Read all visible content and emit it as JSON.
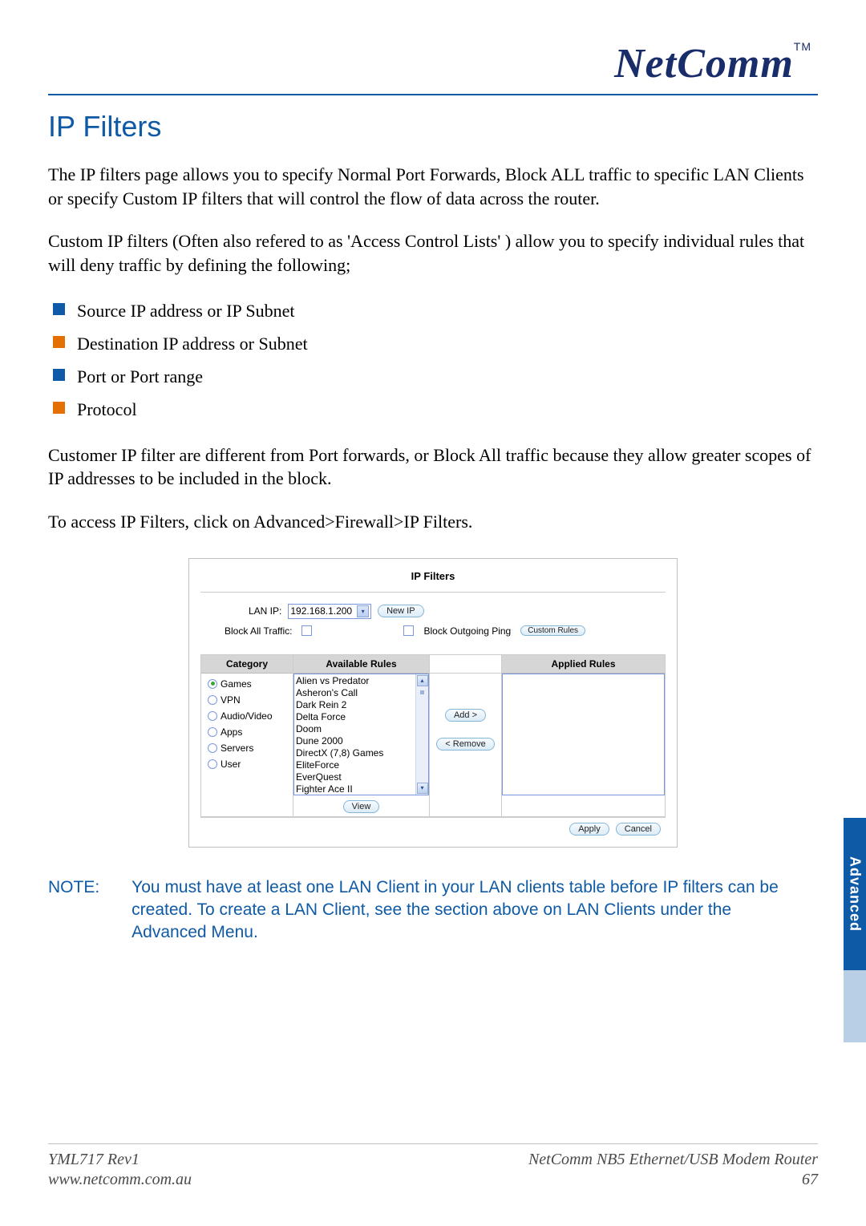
{
  "logo": {
    "text": "NetComm",
    "tm": "TM"
  },
  "title": "IP Filters",
  "paragraphs": {
    "p1": "The IP filters page allows you to specify Normal Port Forwards,  Block ALL traffic to specific LAN Clients or specify Custom IP filters that will control the flow of data across the router.",
    "p2": "Custom IP filters (Often also refered to as 'Access Control Lists' ) allow you to specify individual rules that will deny traffic by defining the following;",
    "p3": "Customer IP filter are different from Port forwards, or Block All traffic because they allow greater scopes of IP addresses to be included in the block.",
    "p4": "To access IP Filters, click on Advanced>Firewall>IP Filters."
  },
  "bullets": [
    "Source IP address or IP Subnet",
    "Destination IP address or Subnet",
    "Port or Port range",
    "Protocol"
  ],
  "panel": {
    "title": "IP Filters",
    "lanIpLabel": "LAN IP:",
    "lanIpValue": "192.168.1.200",
    "newIp": "New IP",
    "blockAllLabel": "Block All Traffic:",
    "blockPingLabel": "Block Outgoing Ping",
    "customRules": "Custom Rules",
    "headers": {
      "category": "Category",
      "available": "Available Rules",
      "applied": "Applied Rules"
    },
    "categories": [
      "Games",
      "VPN",
      "Audio/Video",
      "Apps",
      "Servers",
      "User"
    ],
    "selectedCategory": "Games",
    "availableRules": [
      "Alien vs Predator",
      "Asheron's Call",
      "Dark Rein 2",
      "Delta Force",
      "Doom",
      "Dune 2000",
      "DirectX (7,8) Games",
      "EliteForce",
      "EverQuest",
      "Fighter Ace II"
    ],
    "addBtn": "Add >",
    "removeBtn": "< Remove",
    "viewBtn": "View",
    "applyBtn": "Apply",
    "cancelBtn": "Cancel"
  },
  "note": {
    "label": "NOTE:",
    "body": "You must have at least one LAN Client in your LAN clients table before IP filters can be created. To create a LAN Client, see the section above on LAN Clients under the Advanced Menu."
  },
  "sideTab": "Advanced",
  "footer": {
    "leftTop": "YML717 Rev1",
    "rightTop": "NetComm NB5 Ethernet/USB Modem Router",
    "leftBottom": "www.netcomm.com.au",
    "rightBottom": "67"
  }
}
